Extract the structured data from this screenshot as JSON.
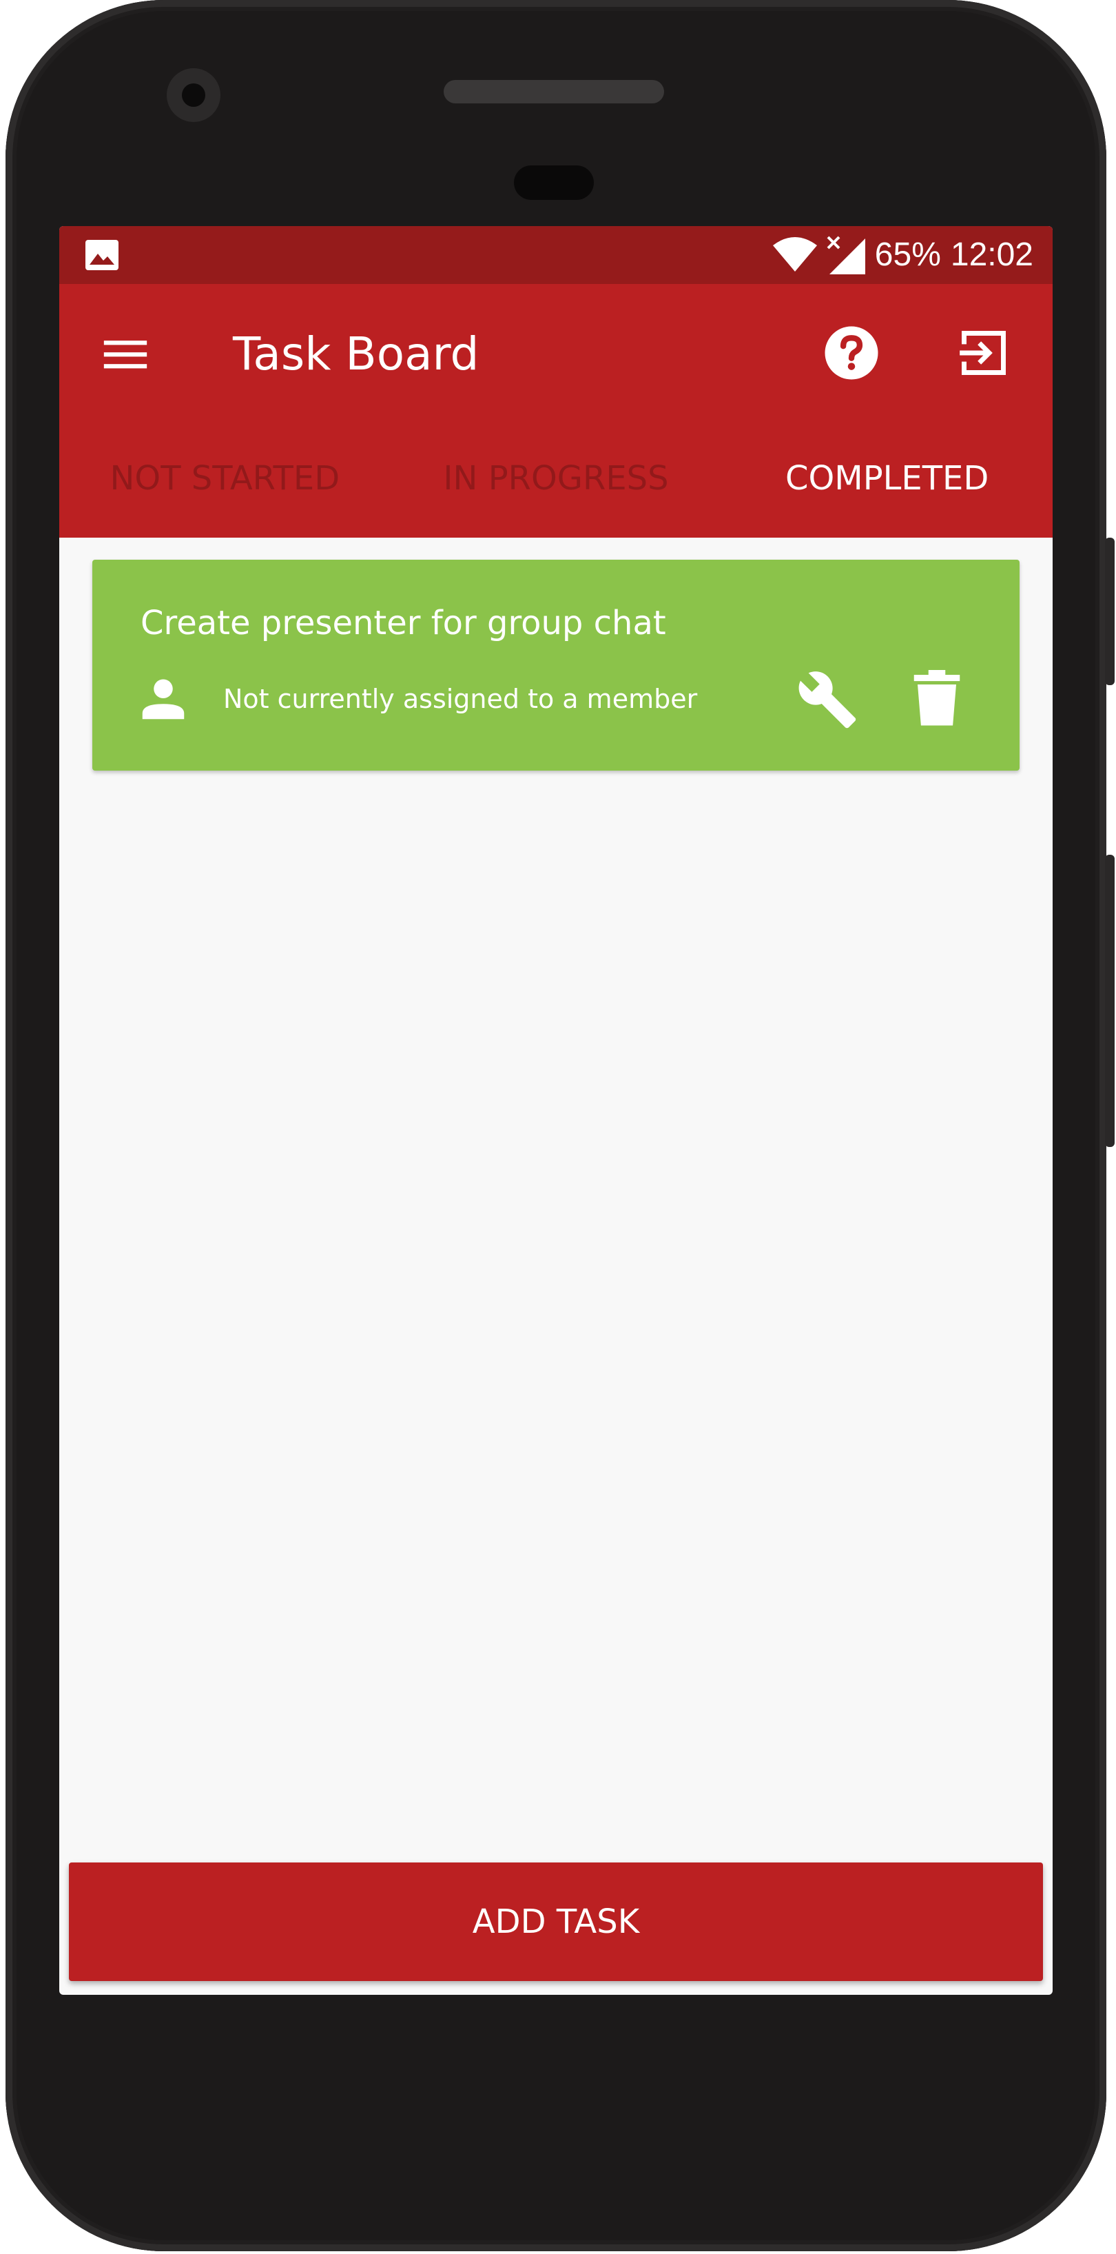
{
  "status_bar": {
    "battery": "65%",
    "time": "12:02",
    "icons": [
      "image-notification-icon",
      "wifi-icon",
      "signal-icon"
    ]
  },
  "app_bar": {
    "title": "Task Board",
    "icons": [
      "menu-icon",
      "help-icon",
      "logout-icon"
    ]
  },
  "tabs": [
    {
      "label": "NOT STARTED",
      "active": false
    },
    {
      "label": "IN PROGRESS",
      "active": false
    },
    {
      "label": "COMPLETED",
      "active": true
    }
  ],
  "tasks": [
    {
      "title": "Create presenter for group chat",
      "assignee": "Not currently assigned to a member",
      "icons": [
        "person-icon",
        "wrench-icon",
        "trash-icon"
      ]
    }
  ],
  "add_button": {
    "label": "ADD TASK"
  },
  "colors": {
    "primary": "#bb2022",
    "primary_dark": "#951b1b",
    "card_completed": "#8bc34a",
    "background": "#f8f8f8"
  }
}
